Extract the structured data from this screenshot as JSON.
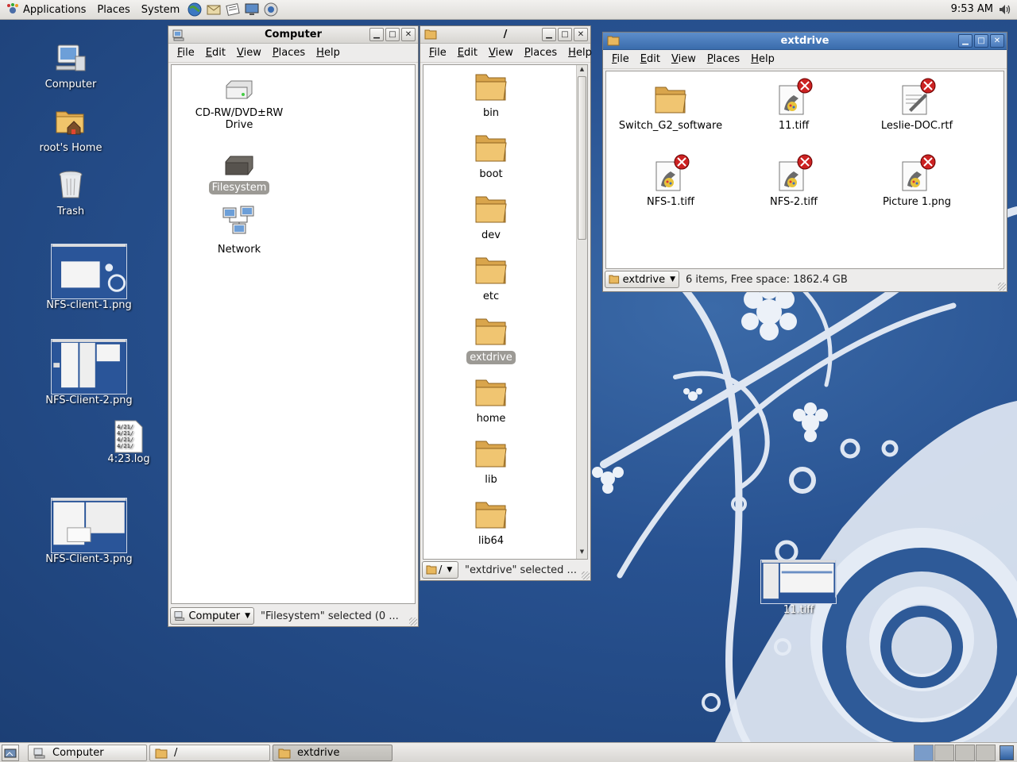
{
  "top_panel": {
    "menus": [
      "Applications",
      "Places",
      "System"
    ],
    "launchers": [
      "web-browser-icon",
      "mail-icon",
      "notes-icon",
      "monitor-icon",
      "help-icon"
    ],
    "clock": "9:53 AM"
  },
  "desktop_icons": [
    {
      "label": "Computer",
      "icon": "computer-icon"
    },
    {
      "label": "root's Home",
      "icon": "home-folder-icon"
    },
    {
      "label": "Trash",
      "icon": "trash-icon"
    },
    {
      "label": "NFS-client-1.png",
      "icon": "image-thumbnail"
    },
    {
      "label": "NFS-Client-2.png",
      "icon": "image-thumbnail"
    },
    {
      "label": "4:23.log",
      "icon": "text-file-icon",
      "preview_lines": [
        "4/21/",
        "4/21/",
        "4/21/",
        "4/21/"
      ]
    },
    {
      "label": "NFS-Client-3.png",
      "icon": "image-thumbnail"
    },
    {
      "label": "11.tiff",
      "icon": "image-thumbnail"
    }
  ],
  "windows": {
    "computer": {
      "title": "Computer",
      "menu": [
        "File",
        "Edit",
        "View",
        "Places",
        "Help"
      ],
      "items": [
        {
          "label": "CD-RW/DVD±RW Drive",
          "icon": "optical-drive-icon"
        },
        {
          "label": "Filesystem",
          "icon": "hard-disk-icon",
          "selected": true
        },
        {
          "label": "Network",
          "icon": "network-icon"
        }
      ],
      "location": "Computer",
      "status": "\"Filesystem\" selected (0 ..."
    },
    "root": {
      "title": "/",
      "menu": [
        "File",
        "Edit",
        "View",
        "Places",
        "Help"
      ],
      "items": [
        {
          "label": "bin"
        },
        {
          "label": "boot"
        },
        {
          "label": "dev"
        },
        {
          "label": "etc"
        },
        {
          "label": "extdrive",
          "selected": true
        },
        {
          "label": "home"
        },
        {
          "label": "lib"
        },
        {
          "label": "lib64"
        }
      ],
      "location": "/",
      "status": "\"extdrive\" selected ..."
    },
    "extdrive": {
      "title": "extdrive",
      "menu": [
        "File",
        "Edit",
        "View",
        "Places",
        "Help"
      ],
      "items": [
        {
          "label": "Switch_G2_software",
          "icon": "folder-icon"
        },
        {
          "label": "11.tiff",
          "icon": "image-file-icon"
        },
        {
          "label": "Leslie-DOC.rtf",
          "icon": "document-file-icon"
        },
        {
          "label": "NFS-1.tiff",
          "icon": "image-file-icon"
        },
        {
          "label": "NFS-2.tiff",
          "icon": "image-file-icon"
        },
        {
          "label": "Picture 1.png",
          "icon": "image-file-icon"
        }
      ],
      "location": "extdrive",
      "status": "6 items, Free space: 1862.4 GB"
    }
  },
  "taskbar": {
    "tasks": [
      {
        "label": "Computer",
        "active": false
      },
      {
        "label": "/",
        "active": false
      },
      {
        "label": "extdrive",
        "active": true
      }
    ],
    "workspaces": 4
  },
  "colors": {
    "title_active": "#3a6cac",
    "selection": "#9c9a95",
    "desktop": "#285291",
    "folder": "#e8b85e"
  }
}
